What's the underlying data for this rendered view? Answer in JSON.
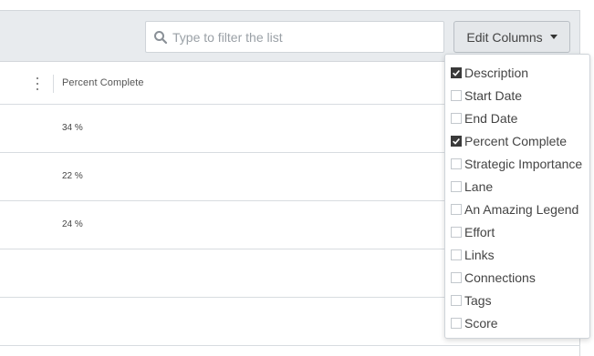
{
  "toolbar": {
    "search": {
      "value": "",
      "placeholder": "Type to filter the list"
    },
    "edit_columns_label": "Edit Columns"
  },
  "table": {
    "column_header": "Percent Complete",
    "rows": [
      {
        "percent": "34 %"
      },
      {
        "percent": "22 %"
      },
      {
        "percent": "24 %"
      },
      {
        "percent": ""
      },
      {
        "percent": ""
      }
    ]
  },
  "columns_menu": {
    "options": [
      {
        "label": "Description",
        "checked": true
      },
      {
        "label": "Start Date",
        "checked": false
      },
      {
        "label": "End Date",
        "checked": false
      },
      {
        "label": "Percent Complete",
        "checked": true
      },
      {
        "label": "Strategic Importance",
        "checked": false
      },
      {
        "label": "Lane",
        "checked": false
      },
      {
        "label": "An Amazing Legend",
        "checked": false
      },
      {
        "label": "Effort",
        "checked": false
      },
      {
        "label": "Links",
        "checked": false
      },
      {
        "label": "Connections",
        "checked": false
      },
      {
        "label": "Tags",
        "checked": false
      },
      {
        "label": "Score",
        "checked": false
      }
    ]
  },
  "icons": {
    "search": "search-icon",
    "caret": "chevron-down-icon",
    "kebab": "kebab-menu-icon",
    "check": "checkmark-icon"
  }
}
